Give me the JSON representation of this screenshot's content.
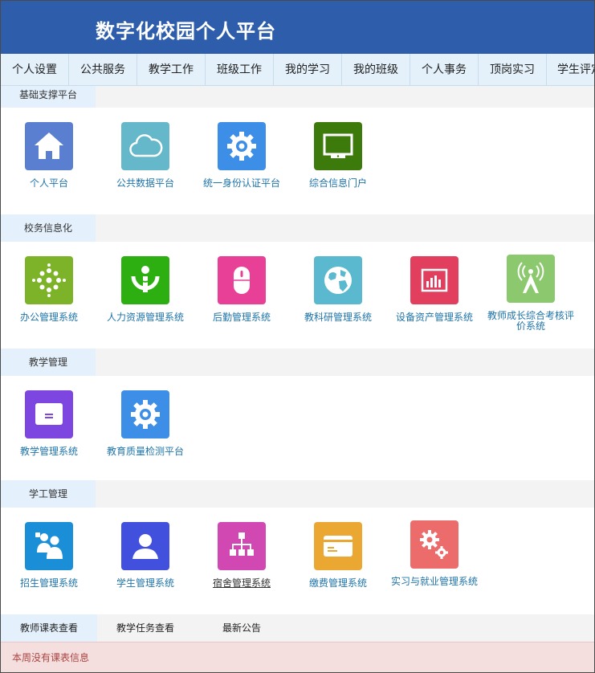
{
  "header": {
    "title": "数字化校园个人平台"
  },
  "nav": {
    "items": [
      {
        "label": "个人设置"
      },
      {
        "label": "公共服务"
      },
      {
        "label": "教学工作"
      },
      {
        "label": "班级工作"
      },
      {
        "label": "我的学习"
      },
      {
        "label": "我的班级"
      },
      {
        "label": "个人事务"
      },
      {
        "label": "顶岗实习"
      },
      {
        "label": "学生评定"
      }
    ]
  },
  "sections": [
    {
      "title": "基础支撑平台",
      "apps": [
        {
          "label": "个人平台",
          "icon": "home-icon",
          "color": "#5b7fd0"
        },
        {
          "label": "公共数据平台",
          "icon": "cloud-icon",
          "color": "#64b8c9"
        },
        {
          "label": "统一身份认证平台",
          "icon": "gear-icon",
          "color": "#3d8ee6"
        },
        {
          "label": "综合信息门户",
          "icon": "monitor-icon",
          "color": "#3c7a0c"
        }
      ]
    },
    {
      "title": "校务信息化",
      "apps": [
        {
          "label": "办公管理系统",
          "icon": "dots-cluster-icon",
          "color": "#7db328"
        },
        {
          "label": "人力资源管理系统",
          "icon": "wikimedia-icon",
          "color": "#2daf12"
        },
        {
          "label": "后勤管理系统",
          "icon": "mouse-icon",
          "color": "#e83f97"
        },
        {
          "label": "教科研管理系统",
          "icon": "globe-icon",
          "color": "#5ab8cf"
        },
        {
          "label": "设备资产管理系统",
          "icon": "bar-chart-icon",
          "color": "#e23f5f"
        },
        {
          "label": "教师成长综合考核评价系统",
          "icon": "antenna-icon",
          "color": "#8cc86d"
        }
      ]
    },
    {
      "title": "教学管理",
      "apps": [
        {
          "label": "教学管理系统",
          "icon": "envelope-icon",
          "color": "#7e46e0"
        },
        {
          "label": "教育质量检测平台",
          "icon": "gear-icon",
          "color": "#3d8ee6"
        }
      ]
    },
    {
      "title": "学工管理",
      "apps": [
        {
          "label": "招生管理系统",
          "icon": "users-icon",
          "color": "#1a8fd8"
        },
        {
          "label": "学生管理系统",
          "icon": "user-icon",
          "color": "#4150dd"
        },
        {
          "label": "宿舍管理系统",
          "icon": "org-chart-icon",
          "color": "#d148b2"
        },
        {
          "label": "缴费管理系统",
          "icon": "card-icon",
          "color": "#eaa832"
        },
        {
          "label": "实习与就业管理系统",
          "icon": "gears-icon",
          "color": "#ec6c6c"
        }
      ]
    }
  ],
  "bottom_tabs": [
    {
      "label": "教师课表查看"
    },
    {
      "label": "教学任务查看"
    },
    {
      "label": "最新公告"
    }
  ],
  "notice": "本周没有课表信息"
}
